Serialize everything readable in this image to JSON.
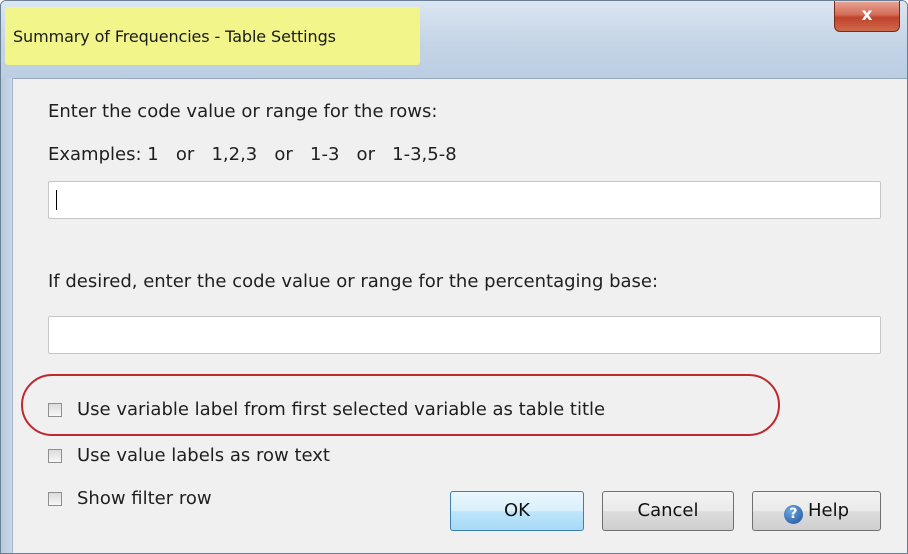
{
  "window": {
    "title": "Summary of Frequencies - Table Settings",
    "close_glyph": "x",
    "highlight_color": "#f2f58a"
  },
  "rows": {
    "prompt": "Enter the code value or range for the rows:",
    "examples": "Examples: 1   or   1,2,3   or   1-3   or   1-3,5-8",
    "value": ""
  },
  "base": {
    "prompt": "If desired, enter the code value or range for the percentaging base:",
    "value": ""
  },
  "options": [
    {
      "label": "Use variable label from first selected variable as table title",
      "checked": false,
      "highlighted": true
    },
    {
      "label": "Use value labels as row text",
      "checked": false
    },
    {
      "label": "Show filter row",
      "checked": false
    }
  ],
  "annotation": {
    "oval_color": "#c0282f"
  },
  "buttons": {
    "ok": "OK",
    "cancel": "Cancel",
    "help": "Help",
    "help_icon": "question-mark-icon"
  }
}
